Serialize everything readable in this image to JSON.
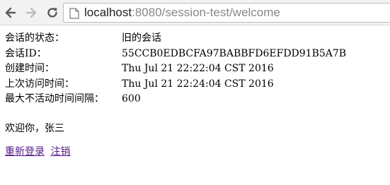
{
  "browser": {
    "url_host": "localhost",
    "url_rest": ":8080/session-test/welcome"
  },
  "session": {
    "rows": [
      {
        "label": "会话的状态：",
        "value": "旧的会话"
      },
      {
        "label": "会话ID：",
        "value": "55CCB0EDBCFA97BABBFD6EFDD91B5A7B"
      },
      {
        "label": "创建时间：",
        "value": "Thu Jul 21 22:22:04 CST 2016"
      },
      {
        "label": "上次访问时间：",
        "value": "Thu Jul 21 22:24:04 CST 2016"
      },
      {
        "label": "最大不活动时间间隔：",
        "value": "600"
      }
    ]
  },
  "welcome_text": "欢迎你，张三",
  "links": {
    "relogin": "重新登录",
    "logout": "注销"
  }
}
